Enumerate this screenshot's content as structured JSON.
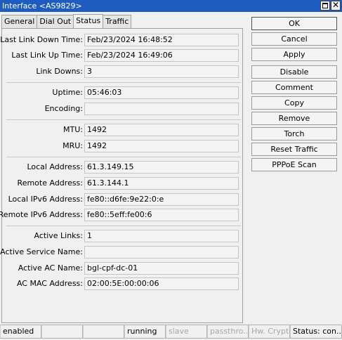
{
  "window": {
    "title": "Interface <AS9829>"
  },
  "tabs": [
    {
      "label": "General"
    },
    {
      "label": "Dial Out"
    },
    {
      "label": "Status",
      "active": true
    },
    {
      "label": "Traffic"
    }
  ],
  "fields": [
    {
      "label": "Last Link Down Time:",
      "value": "Feb/23/2024 16:48:52"
    },
    {
      "label": "Last Link Up Time:",
      "value": "Feb/23/2024 16:49:06"
    },
    {
      "label": "Link Downs:",
      "value": "3"
    },
    {
      "label": "Uptime:",
      "value": "05:46:03"
    },
    {
      "label": "Encoding:",
      "value": ""
    },
    {
      "label": "MTU:",
      "value": "1492"
    },
    {
      "label": "MRU:",
      "value": "1492"
    },
    {
      "label": "Local Address:",
      "value": "61.3.149.15"
    },
    {
      "label": "Remote Address:",
      "value": "61.3.144.1"
    },
    {
      "label": "Local IPv6 Address:",
      "value": "fe80::d6fe:9e22:0:e"
    },
    {
      "label": "Remote IPv6 Address:",
      "value": "fe80::5eff:fe00:6"
    },
    {
      "label": "Active Links:",
      "value": "1"
    },
    {
      "label": "Active Service Name:",
      "value": ""
    },
    {
      "label": "Active AC Name:",
      "value": "bgl-cpf-dc-01"
    },
    {
      "label": "AC MAC Address:",
      "value": "02:00:5E:00:00:06"
    }
  ],
  "buttons": [
    {
      "label": "OK"
    },
    {
      "label": "Cancel"
    },
    {
      "label": "Apply"
    },
    {
      "label": "Disable"
    },
    {
      "label": "Comment"
    },
    {
      "label": "Copy"
    },
    {
      "label": "Remove"
    },
    {
      "label": "Torch"
    },
    {
      "label": "Reset Traffic Counters"
    },
    {
      "label": "PPPoE Scan"
    }
  ],
  "statusbar": [
    {
      "text": "enabled",
      "dim": false
    },
    {
      "text": "",
      "dim": false
    },
    {
      "text": "",
      "dim": false
    },
    {
      "text": "running",
      "dim": false
    },
    {
      "text": "slave",
      "dim": true
    },
    {
      "text": "passthro...",
      "dim": true
    },
    {
      "text": "Hw. Crypto",
      "dim": true
    },
    {
      "text": "Status: con...",
      "dim": false
    }
  ],
  "colors": {
    "titlebar": "#1e5cc0"
  }
}
